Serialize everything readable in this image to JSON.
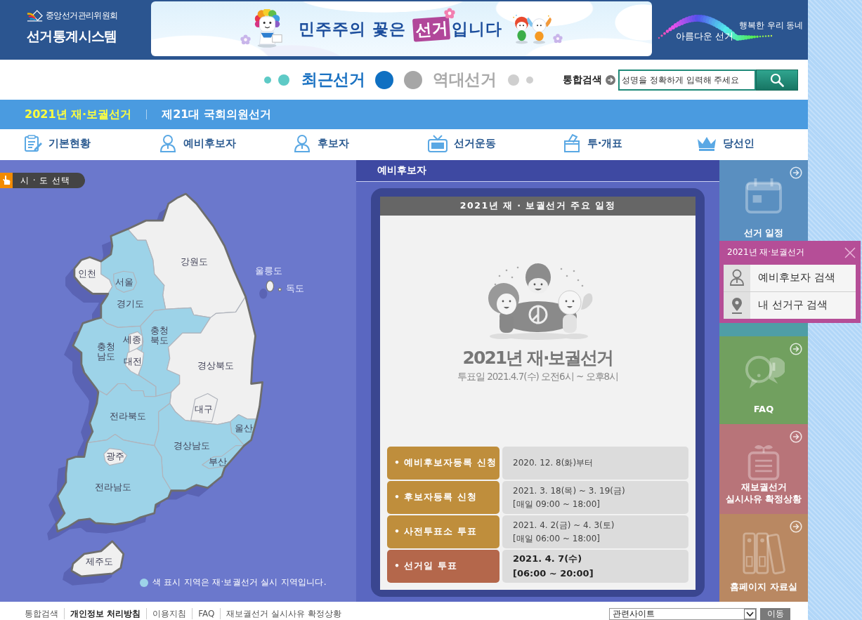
{
  "header": {
    "org_name": "중앙선거관리위원회",
    "system_name": "선거통계시스템",
    "banner": {
      "text_before": "민주주의 꽃은",
      "highlight": "선거",
      "text_after": "입니다"
    },
    "slogan": {
      "main": "아름다운 선거",
      "sub": "행복한 우리 동네"
    }
  },
  "election_switch": [
    {
      "label": "최근선거",
      "selected": true
    },
    {
      "label": "역대선거",
      "selected": false
    }
  ],
  "search": {
    "label": "통합검색",
    "placeholder": "성명을 정확하게 입력해 주세요"
  },
  "election_tabs": [
    {
      "label": "2021년 재·보궐선거",
      "selected": true
    },
    {
      "label": "제21대 국회의원선거",
      "selected": false
    }
  ],
  "nav": [
    {
      "label": "기본현황"
    },
    {
      "label": "예비후보자"
    },
    {
      "label": "후보자"
    },
    {
      "label": "선거운동"
    },
    {
      "label": "투·개표"
    },
    {
      "label": "당선인"
    }
  ],
  "map": {
    "select_button": "시 · 도 선택",
    "regions": [
      {
        "name": "강원도",
        "marked": false
      },
      {
        "name": "인천",
        "marked": false
      },
      {
        "name": "서울",
        "marked": true
      },
      {
        "name": "경기도",
        "marked": true
      },
      {
        "name": "충청북도",
        "marked": true
      },
      {
        "name": "세종",
        "marked": false
      },
      {
        "name": "충청남도",
        "marked": true
      },
      {
        "name": "대전",
        "marked": false
      },
      {
        "name": "경상북도",
        "marked": false
      },
      {
        "name": "대구",
        "marked": false
      },
      {
        "name": "전라북도",
        "marked": true
      },
      {
        "name": "울산",
        "marked": true
      },
      {
        "name": "경상남도",
        "marked": true
      },
      {
        "name": "광주",
        "marked": false
      },
      {
        "name": "부산",
        "marked": true
      },
      {
        "name": "전라남도",
        "marked": true
      },
      {
        "name": "제주도",
        "marked": false
      }
    ],
    "islands": [
      {
        "name": "울릉도"
      },
      {
        "name": "독도"
      }
    ],
    "legend": "색 표시 지역은 재·보궐선거 실시 지역입니다."
  },
  "schedule_panel": {
    "title": "예비후보자",
    "card_title": "2021년 재 · 보궐선거 주요 일정",
    "poster": {
      "title": "2021년 재·보궐선거",
      "subtitle": "투표일 2021.4.7(수) 오전6시 ~ 오후8시"
    },
    "rows": [
      {
        "kind": "period",
        "label": "• 예비후보자등록 신청",
        "value": "2020. 12. 8(화)부터"
      },
      {
        "kind": "period",
        "label": "• 후보자등록 신청",
        "value": "2021. 3. 18(목) ~ 3. 19(금)\n[매일 09:00 ~ 18:00]"
      },
      {
        "kind": "period",
        "label": "• 사전투표소 투표",
        "value": "2021. 4. 2(금) ~ 4. 3(토)\n[매일 06:00 ~ 18:00]"
      },
      {
        "kind": "election_day",
        "label": "• 선거일 투표",
        "value": "2021. 4. 7(수)\n[06:00 ~ 20:00]"
      }
    ]
  },
  "quick_menu": {
    "tiles": [
      {
        "label": "선거 일정",
        "expanded": false
      },
      {
        "expanded": true
      },
      {
        "label": "FAQ",
        "expanded": false
      },
      {
        "label": "재보궐선거\n실시사유 확정상황",
        "expanded": false
      },
      {
        "label": "홈페이지 자료실",
        "expanded": false
      }
    ],
    "popup": {
      "title": "2021년 재·보궐선거",
      "items": [
        {
          "label": "예비후보자 검색"
        },
        {
          "label": "내 선거구 검색"
        }
      ]
    }
  },
  "footer": {
    "links": [
      {
        "label": "통합검색",
        "bold": false
      },
      {
        "label": "개인정보 처리방침",
        "bold": true
      },
      {
        "label": "이용지침",
        "bold": false
      },
      {
        "label": "FAQ",
        "bold": false
      },
      {
        "label": "재보궐선거 실시사유 확정상황",
        "bold": false
      }
    ],
    "site_select": "관련사이트",
    "go_button": "이동"
  }
}
